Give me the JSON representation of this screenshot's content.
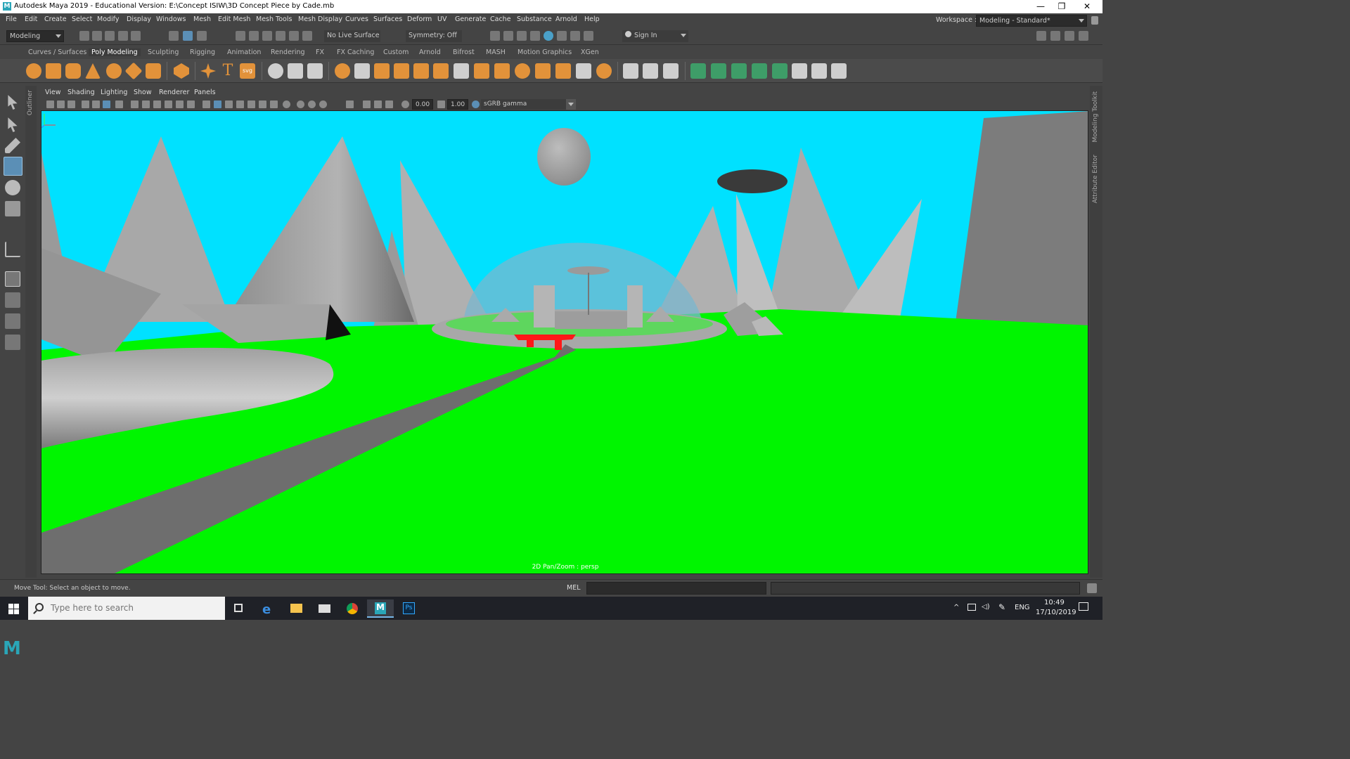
{
  "window": {
    "title": "Autodesk Maya 2019 - Educational Version: E:\\Concept ISIW\\3D Concept Piece by Cade.mb",
    "logo": "M",
    "controls": [
      "—",
      "❐",
      "✕"
    ]
  },
  "menu": {
    "items": [
      "File",
      "Edit",
      "Create",
      "Select",
      "Modify",
      "Display",
      "Windows",
      "Mesh",
      "Edit Mesh",
      "Mesh Tools",
      "Mesh Display",
      "Curves",
      "Surfaces",
      "Deform",
      "UV",
      "Generate",
      "Cache",
      "Substance",
      "Arnold",
      "Help"
    ],
    "workspace_label": "Workspace :",
    "workspace_value": "Modeling - Standard*"
  },
  "status_line": {
    "menuset": "Modeling",
    "live_surface": "No Live Surface",
    "symmetry": "Symmetry: Off",
    "sign_in": "Sign In"
  },
  "shelf": {
    "tabs": [
      "Curves / Surfaces",
      "Poly Modeling",
      "Sculpting",
      "Rigging",
      "Animation",
      "Rendering",
      "FX",
      "FX Caching",
      "Custom",
      "Arnold",
      "Bifrost",
      "MASH",
      "Motion Graphics",
      "XGen"
    ],
    "active_tab": "Poly Modeling",
    "text_tool_glyph": "T",
    "svg_tool_glyph": "svg"
  },
  "toolbox": {
    "outliner_label": "Outliner"
  },
  "panel": {
    "menus": [
      "View",
      "Shading",
      "Lighting",
      "Show",
      "Renderer",
      "Panels"
    ],
    "exposure": "0.00",
    "gamma": "1.00",
    "color_space": "sGRB gamma",
    "camera_label": "2D Pan/Zoom : persp"
  },
  "right_strip": {
    "modeling_toolkit": "Modeling Toolkit",
    "attribute_editor": "Attribute Editor"
  },
  "bottom": {
    "help_line": "Move Tool: Select an object to move.",
    "command_lang": "MEL",
    "command_value": ""
  },
  "taskbar": {
    "search_placeholder": "Type here to search",
    "language": "ENG",
    "time": "10:49",
    "date": "17/10/2019"
  },
  "colors": {
    "sky": "#00e1ff",
    "ground": "#00f500",
    "mountain": "#a9a9a9",
    "accent_orange": "#e2923a",
    "maya_teal": "#2aa6b8"
  }
}
